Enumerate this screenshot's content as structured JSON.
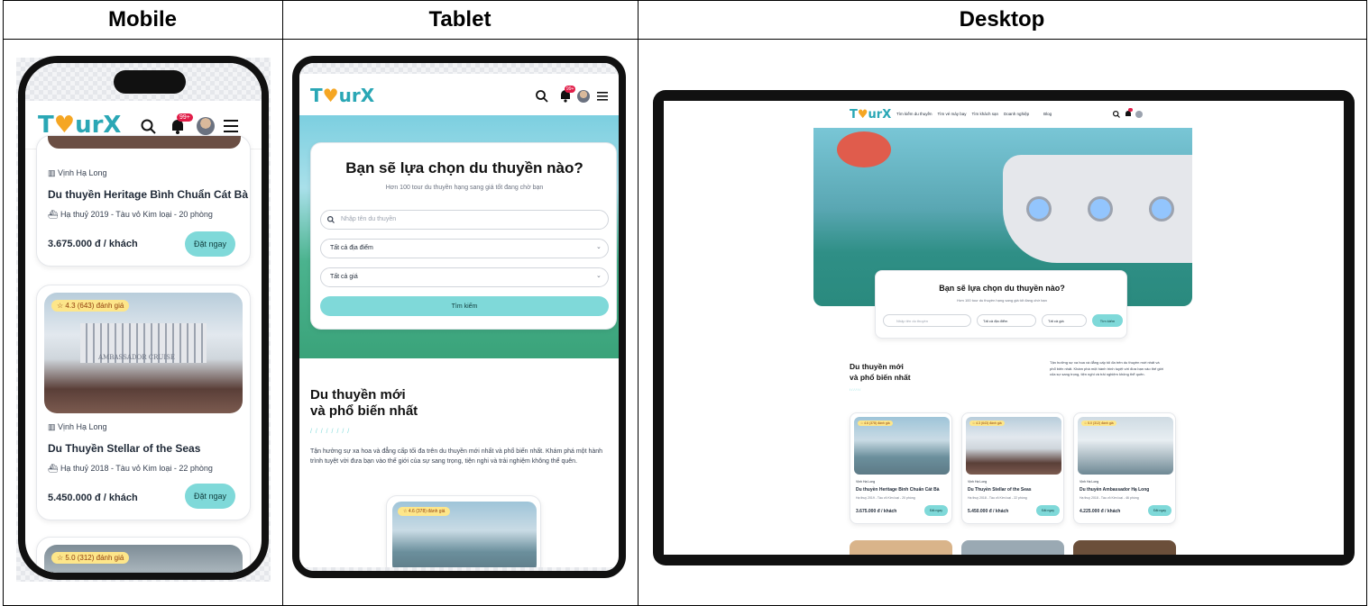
{
  "headers": {
    "mobile": "Mobile",
    "tablet": "Tablet",
    "desktop": "Desktop"
  },
  "brand": {
    "logo_a": "T",
    "logo_b": "♥",
    "logo_c": "urX",
    "notif_count": "99+"
  },
  "mobile": {
    "card1": {
      "location": "Vịnh Hạ Long",
      "title": "Du thuyền Heritage Bình Chuẩn Cát Bà",
      "meta": "Hạ thuỷ 2019 - Tàu vỏ Kim loại - 20 phòng",
      "price": "3.675.000 đ / khách",
      "cta": "Đặt ngay"
    },
    "card2": {
      "rating": "☆ 4.3 (643) đánh giá",
      "location": "Vịnh Hạ Long",
      "title": "Du Thuyền Stellar of the Seas",
      "meta": "Hạ thuỷ 2018 - Tàu vỏ Kim loại - 22 phòng",
      "price": "5.450.000 đ / khách",
      "cta": "Đặt ngay",
      "ship_name": "AMBASSADOR CRUISE"
    },
    "card3": {
      "rating": "☆ 5.0 (312) đánh giá"
    }
  },
  "tablet": {
    "search_title": "Bạn sẽ lựa chọn du thuyền nào?",
    "search_sub": "Hơn 100 tour du thuyền hạng sang giá tốt đang chờ bạn",
    "search_placeholder": "Nhập tên du thuyền",
    "location_select": "Tất cả địa điểm",
    "price_select": "Tất cả giá",
    "search_btn": "Tìm kiếm",
    "section_title_1": "Du thuyền mới",
    "section_title_2": "và phổ biến nhất",
    "section_desc": "Tận hưởng sự xa hoa và đẳng cấp tối đa trên du thuyền mới nhất và phổ biến nhất. Khám phá một hành trình tuyệt vời đưa bạn vào thế giới của sự sang trọng, tiện nghi và trải nghiệm không thể quên.",
    "card_rating": "☆ 4.6 (378) đánh giá"
  },
  "desktop": {
    "nav": [
      "Tìm kiếm du thuyền",
      "Tìm vé máy bay",
      "Tìm khách sạn",
      "Doanh nghiệp",
      "Blog"
    ],
    "search_title": "Bạn sẽ lựa chọn du thuyền nào?",
    "search_sub": "Hơn 100 tour du thuyền hạng sang giá tốt đang chờ bạn",
    "search_placeholder": "Nhập tên du thuyền",
    "location_select": "Tất cả địa điểm",
    "price_select": "Tất cả giá",
    "search_btn": "Tìm kiếm",
    "section_title_1": "Du thuyền mới",
    "section_title_2": "và phổ biến nhất",
    "section_desc": "Tận hưởng sự xa hoa và đẳng cấp tối đa trên du thuyền mới nhất và phổ biến nhất. Khám phá một hành trình tuyệt vời đưa bạn vào thế giới của sự sang trọng, tiện nghi và trải nghiệm không thể quên.",
    "cards": [
      {
        "rating": "☆ 4.6 (378) đánh giá",
        "location": "Vịnh Hạ Long",
        "title": "Du thuyền Heritage Bình Chuẩn Cát Bà",
        "meta": "Hạ thuỷ 2019 - Tàu vỏ Kim loại - 20 phòng",
        "price": "3.675.000 đ / khách",
        "cta": "Đặt ngay"
      },
      {
        "rating": "☆ 4.3 (643) đánh giá",
        "location": "Vịnh Hạ Long",
        "title": "Du Thuyền Stellar of the Seas",
        "meta": "Hạ thuỷ 2018 - Tàu vỏ Kim loại - 22 phòng",
        "price": "5.450.000 đ / khách",
        "cta": "Đặt ngay"
      },
      {
        "rating": "☆ 5.0 (312) đánh giá",
        "location": "Vịnh Hạ Long",
        "title": "Du thuyền Ambassador Hạ Long",
        "meta": "Hạ thuỷ 2018 - Tàu vỏ Kim loại - 46 phòng",
        "price": "4.225.000 đ / khách",
        "cta": "Đặt ngay"
      }
    ]
  },
  "colors": {
    "accent": "#7fd9d9",
    "brand": "#2aa7b5",
    "badge": "#fde68a",
    "notif": "#e11d48"
  }
}
